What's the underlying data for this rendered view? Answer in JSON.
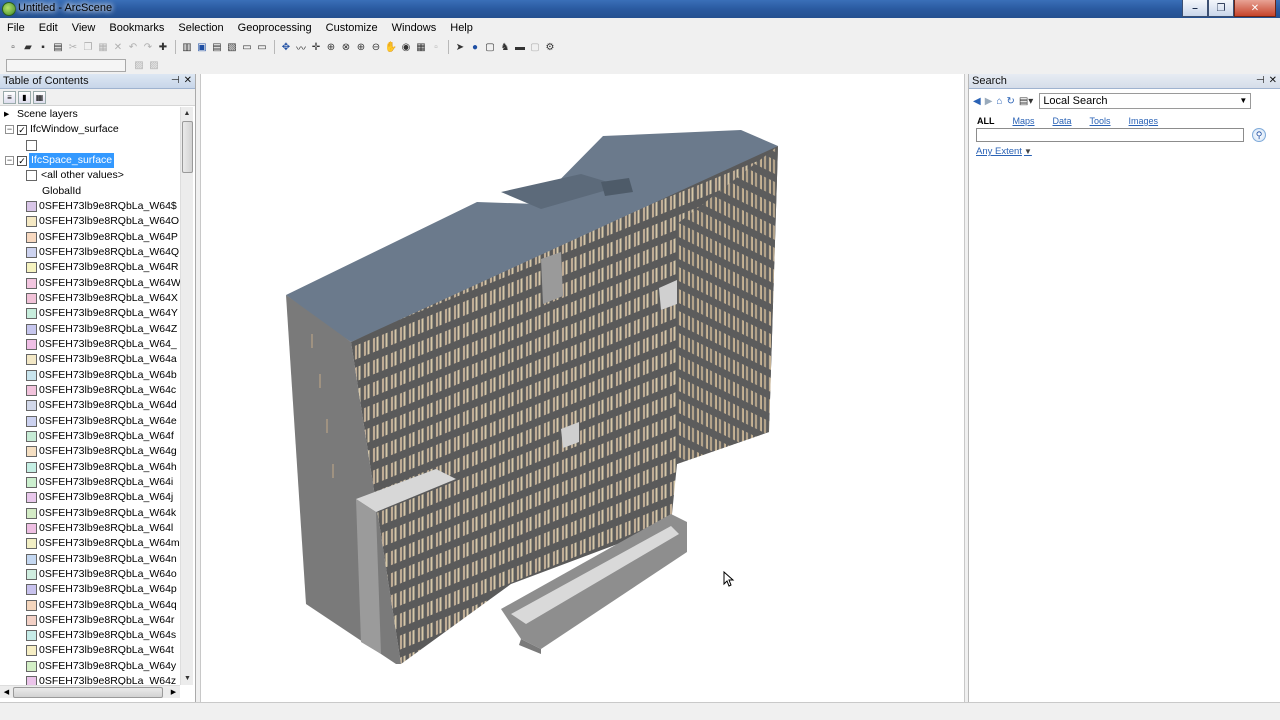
{
  "window": {
    "title": "Untitled - ArcScene"
  },
  "menu": [
    "File",
    "Edit",
    "View",
    "Bookmarks",
    "Selection",
    "Geoprocessing",
    "Customize",
    "Windows",
    "Help"
  ],
  "toc": {
    "title": "Table of Contents",
    "root": "Scene layers",
    "layers": [
      {
        "name": "IfcWindow_surface",
        "checked": true
      },
      {
        "name": "IfcSpace_surface",
        "checked": true,
        "selected": true
      }
    ],
    "other_values": "<all other values>",
    "field": "GlobalId",
    "classes": [
      {
        "label": "0SFEH73lb9e8RQbLa_W64$",
        "color": "#d9c6e8"
      },
      {
        "label": "0SFEH73lb9e8RQbLa_W64O",
        "color": "#f5e9c4"
      },
      {
        "label": "0SFEH73lb9e8RQbLa_W64P",
        "color": "#f8d9c0"
      },
      {
        "label": "0SFEH73lb9e8RQbLa_W64Q",
        "color": "#cdd3f0"
      },
      {
        "label": "0SFEH73lb9e8RQbLa_W64R",
        "color": "#f6f3c0"
      },
      {
        "label": "0SFEH73lb9e8RQbLa_W64W",
        "color": "#f3c6e0"
      },
      {
        "label": "0SFEH73lb9e8RQbLa_W64X",
        "color": "#f1c2d8"
      },
      {
        "label": "0SFEH73lb9e8RQbLa_W64Y",
        "color": "#c8eedd"
      },
      {
        "label": "0SFEH73lb9e8RQbLa_W64Z",
        "color": "#c6c6ee"
      },
      {
        "label": "0SFEH73lb9e8RQbLa_W64_",
        "color": "#f0bfe6"
      },
      {
        "label": "0SFEH73lb9e8RQbLa_W64a",
        "color": "#f3e8c6"
      },
      {
        "label": "0SFEH73lb9e8RQbLa_W64b",
        "color": "#c9e5ee"
      },
      {
        "label": "0SFEH73lb9e8RQbLa_W64c",
        "color": "#f2c3dc"
      },
      {
        "label": "0SFEH73lb9e8RQbLa_W64d",
        "color": "#d2d8ea"
      },
      {
        "label": "0SFEH73lb9e8RQbLa_W64e",
        "color": "#ccd2f0"
      },
      {
        "label": "0SFEH73lb9e8RQbLa_W64f",
        "color": "#c7ecd6"
      },
      {
        "label": "0SFEH73lb9e8RQbLa_W64g",
        "color": "#f5dfc2"
      },
      {
        "label": "0SFEH73lb9e8RQbLa_W64h",
        "color": "#c5efe4"
      },
      {
        "label": "0SFEH73lb9e8RQbLa_W64i",
        "color": "#ccf0cf"
      },
      {
        "label": "0SFEH73lb9e8RQbLa_W64j",
        "color": "#e9c8ec"
      },
      {
        "label": "0SFEH73lb9e8RQbLa_W64k",
        "color": "#d4ecc6"
      },
      {
        "label": "0SFEH73lb9e8RQbLa_W64l",
        "color": "#eebfe3"
      },
      {
        "label": "0SFEH73lb9e8RQbLa_W64m",
        "color": "#f2efc4"
      },
      {
        "label": "0SFEH73lb9e8RQbLa_W64n",
        "color": "#c4d8f2"
      },
      {
        "label": "0SFEH73lb9e8RQbLa_W64o",
        "color": "#d0eee0"
      },
      {
        "label": "0SFEH73lb9e8RQbLa_W64p",
        "color": "#c8c2ee"
      },
      {
        "label": "0SFEH73lb9e8RQbLa_W64q",
        "color": "#f5d6bd"
      },
      {
        "label": "0SFEH73lb9e8RQbLa_W64r",
        "color": "#f3d1c6"
      },
      {
        "label": "0SFEH73lb9e8RQbLa_W64s",
        "color": "#c6ece8"
      },
      {
        "label": "0SFEH73lb9e8RQbLa_W64t",
        "color": "#f6eec4"
      },
      {
        "label": "0SFEH73lb9e8RQbLa_W64y",
        "color": "#d3efc6"
      },
      {
        "label": "0SFEH73lb9e8RQbLa_W64z",
        "color": "#ebc4ea"
      }
    ]
  },
  "search": {
    "title": "Search",
    "scope": "Local Search",
    "tabs": [
      "ALL",
      "Maps",
      "Data",
      "Tools",
      "Images"
    ],
    "query": "",
    "extent": "Any Extent"
  }
}
